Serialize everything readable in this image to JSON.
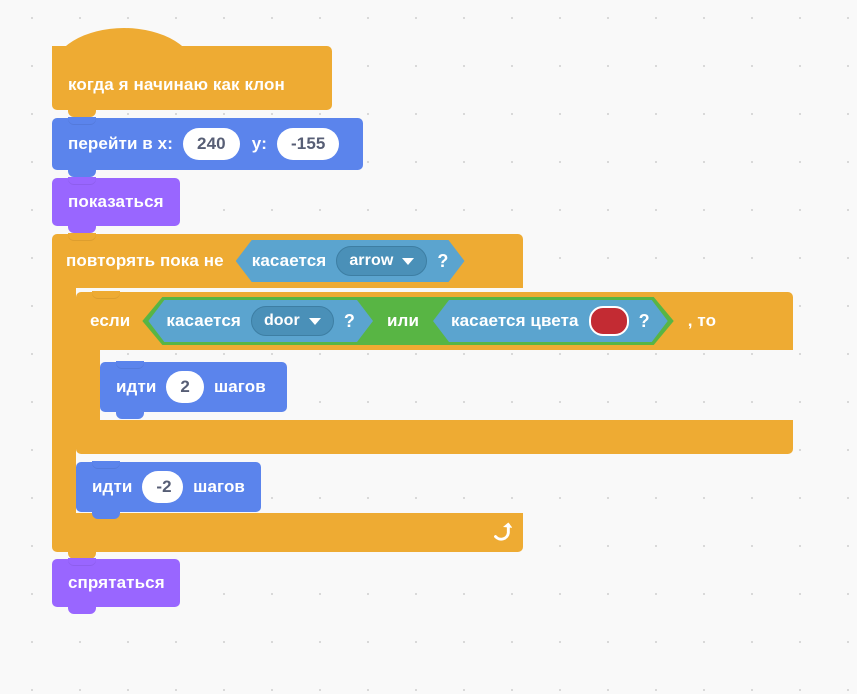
{
  "editor": {
    "language": "ru",
    "background_color": "#f9f9f9",
    "grid_dot_color": "#d9d9d9"
  },
  "palette": {
    "events": "#eeab33",
    "control": "#eeab33",
    "motion": "#5b84ec",
    "looks": "#9966ff",
    "sensing": "#5ba4cf",
    "operators": "#58b544",
    "input_text": "#575e75",
    "dropdown_fill": "#4a90b8"
  },
  "script": {
    "hat": {
      "label": "когда я начинаю как клон"
    },
    "goto_xy": {
      "label_x": "перейти в x:",
      "value_x": "240",
      "label_y": "y:",
      "value_y": "-155"
    },
    "show": {
      "label": "показаться"
    },
    "repeat_until": {
      "label": "повторять пока не",
      "condition": {
        "label": "касается",
        "target": "arrow",
        "qmark": "?"
      },
      "loop_arrow_icon": "loop-arrow-icon"
    },
    "if_then": {
      "label_if": "если",
      "label_then": ", то",
      "operator": {
        "label": "или"
      },
      "condition_left": {
        "label": "касается",
        "target": "door",
        "qmark": "?"
      },
      "condition_right": {
        "label": "касается цвета",
        "color_value": "#c32b33",
        "qmark": "?"
      }
    },
    "move_inner": {
      "label_prefix": "идти",
      "value": "2",
      "label_suffix": "шагов"
    },
    "move_outer": {
      "label_prefix": "идти",
      "value": "-2",
      "label_suffix": "шагов"
    },
    "hide": {
      "label": "спрятаться"
    }
  }
}
